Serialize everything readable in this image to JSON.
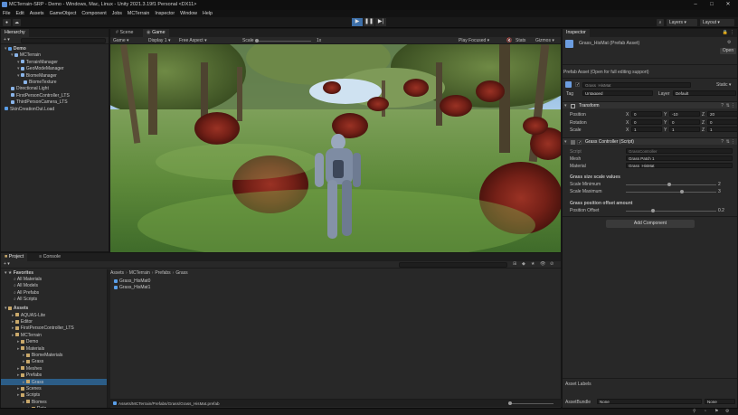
{
  "window": {
    "title": "MCTerrain-SRP - Demo - Windows, Mac, Linux - Unity 2021.3.19f1 Personal <DX11>"
  },
  "menu": [
    "File",
    "Edit",
    "Assets",
    "GameObject",
    "Component",
    "Jobs",
    "MCTerrain",
    "Inspector",
    "Window",
    "Help"
  ],
  "toolbar": {
    "layers_label": "Layers",
    "layout_label": "Layout"
  },
  "hierarchy": {
    "tab": "Hierarchy",
    "items": [
      {
        "label": "Demo",
        "depth": 0
      },
      {
        "label": "MCTerrain",
        "depth": 1
      },
      {
        "label": "TerrainManager",
        "depth": 2
      },
      {
        "label": "GeoModeManager",
        "depth": 2
      },
      {
        "label": "BiomeManager",
        "depth": 2
      },
      {
        "label": "BiomeTexture",
        "depth": 3
      },
      {
        "label": "Directional Light",
        "depth": 1
      },
      {
        "label": "FirstPersonController_LTS",
        "depth": 1
      },
      {
        "label": "ThirdPersonCamera_LTS",
        "depth": 1
      },
      {
        "label": "SkinCreationOut.Load",
        "depth": 0
      }
    ]
  },
  "scene_tabs": {
    "scene": "Scene",
    "game": "Game"
  },
  "game_bar": {
    "display": "Game",
    "display_num": "Display 1",
    "aspect": "Free Aspect",
    "scale_label": "Scale",
    "scale_value": "1x",
    "play_focused": "Play Focused",
    "stats": "Stats",
    "gizmos": "Gizmos"
  },
  "inspector": {
    "tab": "Inspector",
    "object_name": "Grass_HisMat (Prefab Asset)",
    "open_label": "Open",
    "note": "Prefab Asset (Open for full editing support)",
    "root_name": "Grass_HisMat",
    "static_label": "Static",
    "tag_label": "Tag",
    "tag_value": "Untagged",
    "layer_label": "Layer",
    "layer_value": "Default",
    "transform": {
      "title": "Transform",
      "rows": [
        {
          "label": "Position",
          "x": "0",
          "y": "-10",
          "z": "20"
        },
        {
          "label": "Rotation",
          "x": "0",
          "y": "0",
          "z": "0"
        },
        {
          "label": "Scale",
          "x": "1",
          "y": "1",
          "z": "1"
        }
      ]
    },
    "grass_controller": {
      "title": "Grass Controller (Script)",
      "script_label": "Script",
      "script_value": "GrassController",
      "mesh_label": "Mesh",
      "mesh_value": "Grass Patch 1",
      "material_label": "Material",
      "material_value": "Grass_HisMat",
      "section1": "Grass size scale values",
      "scale_min_label": "Scale Minimum",
      "scale_min_value": "2",
      "scale_min_fraction": 0.48,
      "scale_max_label": "Scale Maximum",
      "scale_max_value": "3",
      "scale_max_fraction": 0.62,
      "section2": "Grass position offset amount",
      "pos_offset_label": "Position Offset",
      "pos_offset_value": "0.2",
      "pos_offset_fraction": 0.3
    },
    "add_component": "Add Component",
    "asset_labels": "Asset Labels",
    "asset_bundle_label": "AssetBundle",
    "asset_bundle_value": "None",
    "asset_bundle_variant": "None"
  },
  "project": {
    "tabs": [
      "Project",
      "Console"
    ],
    "favorites_title": "Favorites",
    "favorites": [
      "All Materials",
      "All Models",
      "All Prefabs",
      "All Scripts"
    ],
    "assets_title": "Assets",
    "tree": [
      {
        "label": "AQUAS-Lite",
        "depth": 1
      },
      {
        "label": "Editor",
        "depth": 1
      },
      {
        "label": "FirstPersonController_LTS",
        "depth": 1
      },
      {
        "label": "MCTerrain",
        "depth": 1
      },
      {
        "label": "Demo",
        "depth": 2
      },
      {
        "label": "Materials",
        "depth": 2
      },
      {
        "label": "BiomeMaterials",
        "depth": 3
      },
      {
        "label": "Grass",
        "depth": 3
      },
      {
        "label": "Meshes",
        "depth": 2
      },
      {
        "label": "Prefabs",
        "depth": 2
      },
      {
        "label": "Grass",
        "depth": 3
      },
      {
        "label": "Scenes",
        "depth": 2
      },
      {
        "label": "Scripts",
        "depth": 2
      },
      {
        "label": "Biomes",
        "depth": 3
      },
      {
        "label": "Data",
        "depth": 4
      }
    ],
    "breadcrumb": [
      "Assets",
      "MCTerrain",
      "Prefabs",
      "Grass"
    ],
    "files": [
      "Grass_HisMat0",
      "Grass_HisMat1"
    ],
    "path_footer": "Assets/MCTerrain/Prefabs/Grass/Grass_HisMat.prefab"
  },
  "colors": {
    "play_active": "#3d6fa8",
    "selection": "#2c5d87",
    "panel": "#282828",
    "bush": "#7a2419"
  }
}
